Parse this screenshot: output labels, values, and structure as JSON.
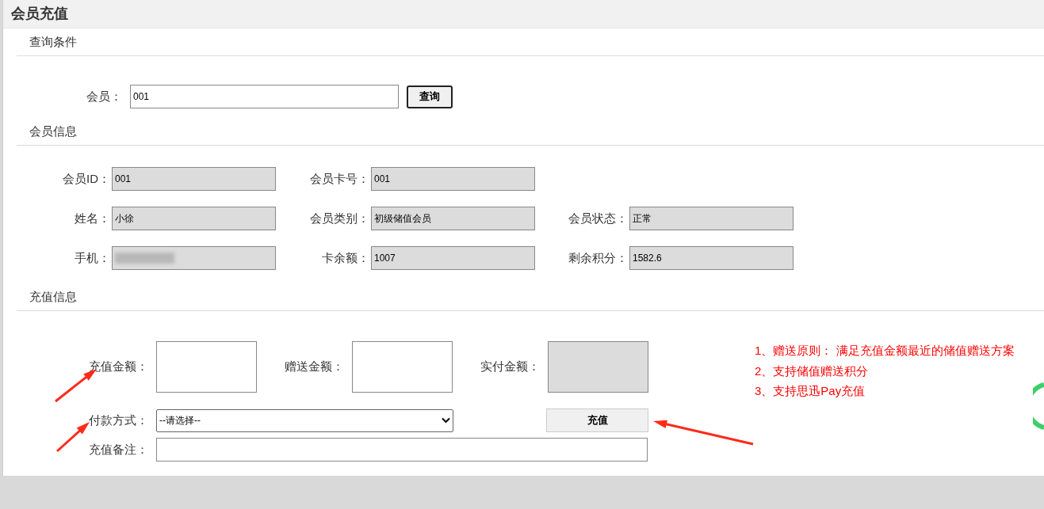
{
  "title": "会员充值",
  "query": {
    "heading": "查询条件",
    "label": "会员：",
    "value": "001",
    "button": "查询"
  },
  "info": {
    "heading": "会员信息",
    "rows": [
      [
        {
          "label": "会员ID：",
          "value": "001"
        },
        {
          "label": "会员卡号：",
          "value": "001"
        }
      ],
      [
        {
          "label": "姓名：",
          "value": "小徐"
        },
        {
          "label": "会员类别：",
          "value": "初级储值会员"
        },
        {
          "label": "会员状态：",
          "value": "正常"
        }
      ],
      [
        {
          "label": "手机：",
          "redacted": true
        },
        {
          "label": "卡余额：",
          "value": "1007"
        },
        {
          "label": "剩余积分：",
          "value": "1582.6"
        }
      ]
    ]
  },
  "recharge": {
    "heading": "充值信息",
    "amounts": [
      {
        "label": "充值金额：",
        "readonly": false
      },
      {
        "label": "赠送金额：",
        "readonly": false
      },
      {
        "label": "实付金额：",
        "readonly": true
      }
    ],
    "payment": {
      "label": "付款方式：",
      "value": "--请选择--"
    },
    "button": "充值",
    "remark": {
      "label": "充值备注："
    },
    "notes": [
      "1、赠送原则： 满足充值金额最近的储值赠送方案",
      "2、支持储值赠送积分",
      "3、支持思迅Pay充值"
    ]
  }
}
